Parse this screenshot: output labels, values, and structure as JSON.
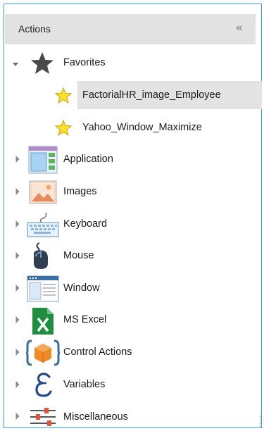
{
  "panel": {
    "title": "Actions",
    "collapse_glyph": "«"
  },
  "tree": {
    "favorites": {
      "label": "Favorites",
      "icon": "star-icon",
      "children": [
        {
          "label": "FactorialHR_image_Employee",
          "icon": "favorite-star-icon",
          "selected": true
        },
        {
          "label": "Yahoo_Window_Maximize",
          "icon": "favorite-star-icon",
          "selected": false
        }
      ]
    },
    "categories": [
      {
        "label": "Application",
        "icon": "application-icon"
      },
      {
        "label": "Images",
        "icon": "image-icon"
      },
      {
        "label": "Keyboard",
        "icon": "keyboard-icon"
      },
      {
        "label": "Mouse",
        "icon": "mouse-icon"
      },
      {
        "label": "Window",
        "icon": "window-icon"
      },
      {
        "label": "MS Excel",
        "icon": "excel-icon"
      },
      {
        "label": "Control Actions",
        "icon": "control-actions-icon"
      },
      {
        "label": "Variables",
        "icon": "variables-icon"
      },
      {
        "label": "Miscellaneous",
        "icon": "miscellaneous-icon"
      }
    ]
  },
  "colors": {
    "border": "#2aa6e6",
    "header_bg": "#e2e2e2",
    "selected_bg": "#e3e3e3",
    "star_yellow": "#ffe12b",
    "excel_green": "#1f8f3f"
  }
}
